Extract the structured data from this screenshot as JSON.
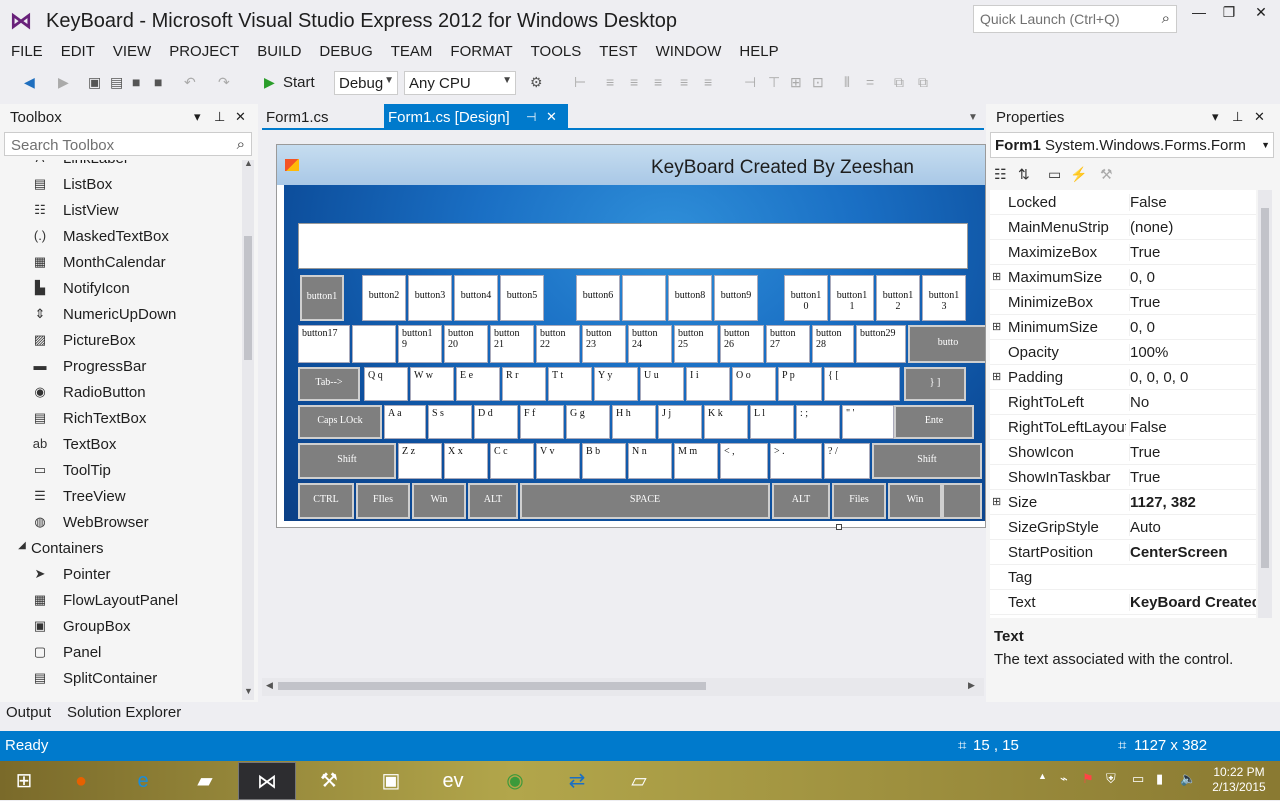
{
  "window": {
    "title": "KeyBoard - Microsoft Visual Studio Express 2012 for Windows Desktop",
    "quick_launch_placeholder": "Quick Launch (Ctrl+Q)"
  },
  "menu": [
    "FILE",
    "EDIT",
    "VIEW",
    "PROJECT",
    "BUILD",
    "DEBUG",
    "TEAM",
    "FORMAT",
    "TOOLS",
    "TEST",
    "WINDOW",
    "HELP"
  ],
  "toolbar": {
    "start": "Start",
    "config": "Debug",
    "platform": "Any CPU"
  },
  "toolbox": {
    "title": "Toolbox",
    "search_placeholder": "Search Toolbox",
    "items": [
      {
        "label": "LinkLabel",
        "icon": "linklabel-icon"
      },
      {
        "label": "ListBox",
        "icon": "listbox-icon"
      },
      {
        "label": "ListView",
        "icon": "listview-icon"
      },
      {
        "label": "MaskedTextBox",
        "icon": "maskedtextbox-icon"
      },
      {
        "label": "MonthCalendar",
        "icon": "calendar-icon"
      },
      {
        "label": "NotifyIcon",
        "icon": "notifyicon-icon"
      },
      {
        "label": "NumericUpDown",
        "icon": "numericupdown-icon"
      },
      {
        "label": "PictureBox",
        "icon": "picturebox-icon"
      },
      {
        "label": "ProgressBar",
        "icon": "progressbar-icon"
      },
      {
        "label": "RadioButton",
        "icon": "radiobutton-icon"
      },
      {
        "label": "RichTextBox",
        "icon": "richtextbox-icon"
      },
      {
        "label": "TextBox",
        "icon": "textbox-icon"
      },
      {
        "label": "ToolTip",
        "icon": "tooltip-icon"
      },
      {
        "label": "TreeView",
        "icon": "treeview-icon"
      },
      {
        "label": "WebBrowser",
        "icon": "webbrowser-icon"
      },
      {
        "label": "Containers",
        "icon": "collapse-triangle-icon",
        "category": true
      },
      {
        "label": "Pointer",
        "icon": "pointer-icon"
      },
      {
        "label": "FlowLayoutPanel",
        "icon": "flowlayoutpanel-icon"
      },
      {
        "label": "GroupBox",
        "icon": "groupbox-icon"
      },
      {
        "label": "Panel",
        "icon": "panel-icon"
      },
      {
        "label": "SplitContainer",
        "icon": "splitcontainer-icon"
      }
    ]
  },
  "tabs": {
    "form_code": "Form1.cs",
    "form_design": "Form1.cs [Design]"
  },
  "form": {
    "title": "KeyBoard Created By Zeeshan",
    "rows": [
      [
        {
          "t": "button1",
          "g": true
        },
        {
          "t": "button2"
        },
        {
          "t": "button3"
        },
        {
          "t": "button4"
        },
        {
          "t": "button5"
        },
        {
          "t": "button6"
        },
        {
          "t": ""
        },
        {
          "t": "button8"
        },
        {
          "t": "button9"
        },
        {
          "t": "button1 0"
        },
        {
          "t": "button1 1"
        },
        {
          "t": "button1 2"
        },
        {
          "t": "button1 3"
        }
      ],
      [
        {
          "t": "button17"
        },
        {
          "t": ""
        },
        {
          "t": "button1 9"
        },
        {
          "t": "button 20"
        },
        {
          "t": "button 21"
        },
        {
          "t": "button 22"
        },
        {
          "t": "button 23"
        },
        {
          "t": "button 24"
        },
        {
          "t": "button 25"
        },
        {
          "t": "button 26"
        },
        {
          "t": "button 27"
        },
        {
          "t": "button 28"
        },
        {
          "t": "button29"
        },
        {
          "t": "butto",
          "g": true
        }
      ],
      [
        {
          "t": "Tab-->",
          "g": true
        },
        {
          "t": "Q q"
        },
        {
          "t": "W w"
        },
        {
          "t": "E e"
        },
        {
          "t": "R r"
        },
        {
          "t": "T t"
        },
        {
          "t": "Y y"
        },
        {
          "t": "U u"
        },
        {
          "t": "I i"
        },
        {
          "t": "O o"
        },
        {
          "t": "P p"
        },
        {
          "t": "{ ["
        },
        {
          "t": "} ]",
          "g": true
        }
      ],
      [
        {
          "t": "Caps LOck",
          "g": true
        },
        {
          "t": "A a"
        },
        {
          "t": "S s"
        },
        {
          "t": "D d"
        },
        {
          "t": "F f"
        },
        {
          "t": "G g"
        },
        {
          "t": "H h"
        },
        {
          "t": "J j"
        },
        {
          "t": "K k"
        },
        {
          "t": "L l"
        },
        {
          "t": ": ;"
        },
        {
          "t": "\" '"
        },
        {
          "t": "Ente",
          "g": true
        }
      ],
      [
        {
          "t": "Shift",
          "g": true
        },
        {
          "t": "Z z"
        },
        {
          "t": "X x"
        },
        {
          "t": "C c"
        },
        {
          "t": "V v"
        },
        {
          "t": "B b"
        },
        {
          "t": "N n"
        },
        {
          "t": "M m"
        },
        {
          "t": "< ,"
        },
        {
          "t": "> ."
        },
        {
          "t": "? /"
        },
        {
          "t": "Shift",
          "g": true
        }
      ],
      [
        {
          "t": "CTRL",
          "g": true
        },
        {
          "t": "FIles",
          "g": true
        },
        {
          "t": "Win",
          "g": true
        },
        {
          "t": "ALT",
          "g": true
        },
        {
          "t": "SPACE",
          "g": true
        },
        {
          "t": "ALT",
          "g": true
        },
        {
          "t": "Files",
          "g": true
        },
        {
          "t": "Win",
          "g": true
        },
        {
          "t": "",
          "g": true
        }
      ]
    ]
  },
  "properties": {
    "title": "Properties",
    "object": "Form1",
    "object_type": "System.Windows.Forms.Form",
    "rows": [
      {
        "n": "Locked",
        "v": "False"
      },
      {
        "n": "MainMenuStrip",
        "v": "(none)"
      },
      {
        "n": "MaximizeBox",
        "v": "True"
      },
      {
        "n": "MaximumSize",
        "v": "0, 0",
        "exp": true
      },
      {
        "n": "MinimizeBox",
        "v": "True"
      },
      {
        "n": "MinimumSize",
        "v": "0, 0",
        "exp": true
      },
      {
        "n": "Opacity",
        "v": "100%"
      },
      {
        "n": "Padding",
        "v": "0, 0, 0, 0",
        "exp": true
      },
      {
        "n": "RightToLeft",
        "v": "No"
      },
      {
        "n": "RightToLeftLayout",
        "v": "False"
      },
      {
        "n": "ShowIcon",
        "v": "True"
      },
      {
        "n": "ShowInTaskbar",
        "v": "True"
      },
      {
        "n": "Size",
        "v": "1127, 382",
        "exp": true,
        "bold": true
      },
      {
        "n": "SizeGripStyle",
        "v": "Auto"
      },
      {
        "n": "StartPosition",
        "v": "CenterScreen",
        "bold": true
      },
      {
        "n": "Tag",
        "v": ""
      },
      {
        "n": "Text",
        "v": "KeyBoard Created By Zeeshan",
        "bold": true
      }
    ],
    "desc_title": "Text",
    "desc_text": "The text associated with the control."
  },
  "bottom_tabs": [
    "Output",
    "Solution Explorer"
  ],
  "status": {
    "text": "Ready",
    "position": "15 , 15",
    "size": "1127 x 382"
  },
  "taskbar": {
    "apps": [
      "windows-start-icon",
      "firefox-icon",
      "internet-explorer-icon",
      "file-explorer-icon",
      "visual-studio-icon",
      "tools-icon",
      "remote-desktop-icon",
      "evo-icon",
      "chrome-icon",
      "teamviewer-icon",
      "notepad-icon"
    ],
    "time": "10:22 PM",
    "date": "2/13/2015"
  }
}
